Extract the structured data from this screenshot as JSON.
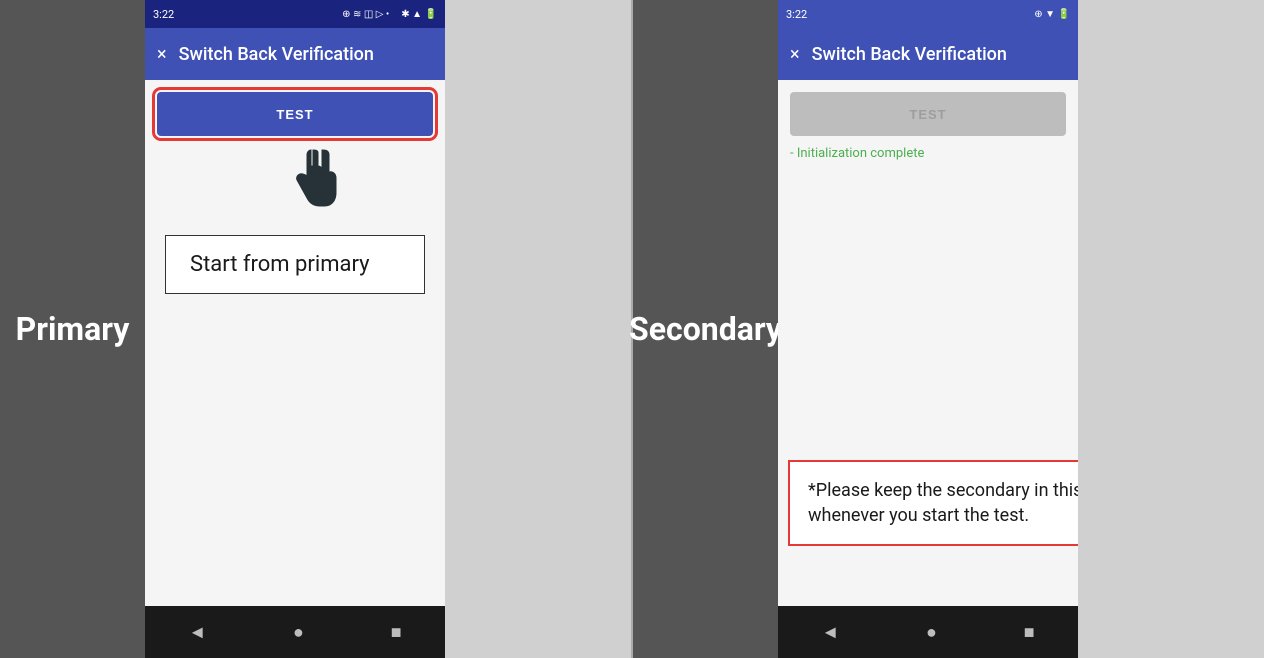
{
  "left": {
    "panel_label": "Primary",
    "status_bar": {
      "time": "3:22",
      "icons": "⊕ ≋ ◫ ▷ •"
    },
    "app_bar": {
      "close": "×",
      "title": "Switch Back Verification"
    },
    "test_button": "TEST",
    "start_box_text": "Start from primary",
    "nav": {
      "back": "◄",
      "home": "●",
      "recents": "■"
    }
  },
  "right": {
    "panel_label": "Secondary",
    "status_bar": {
      "time": "3:22",
      "icons": "⊕ ▼ ■"
    },
    "app_bar": {
      "close": "×",
      "title": "Switch Back Verification"
    },
    "test_button": "TEST",
    "init_text": "- Initialization complete",
    "notice_text": "*Please keep the secondary in this state whenever you start the test.",
    "nav": {
      "back": "◄",
      "home": "●",
      "recents": "■"
    }
  }
}
